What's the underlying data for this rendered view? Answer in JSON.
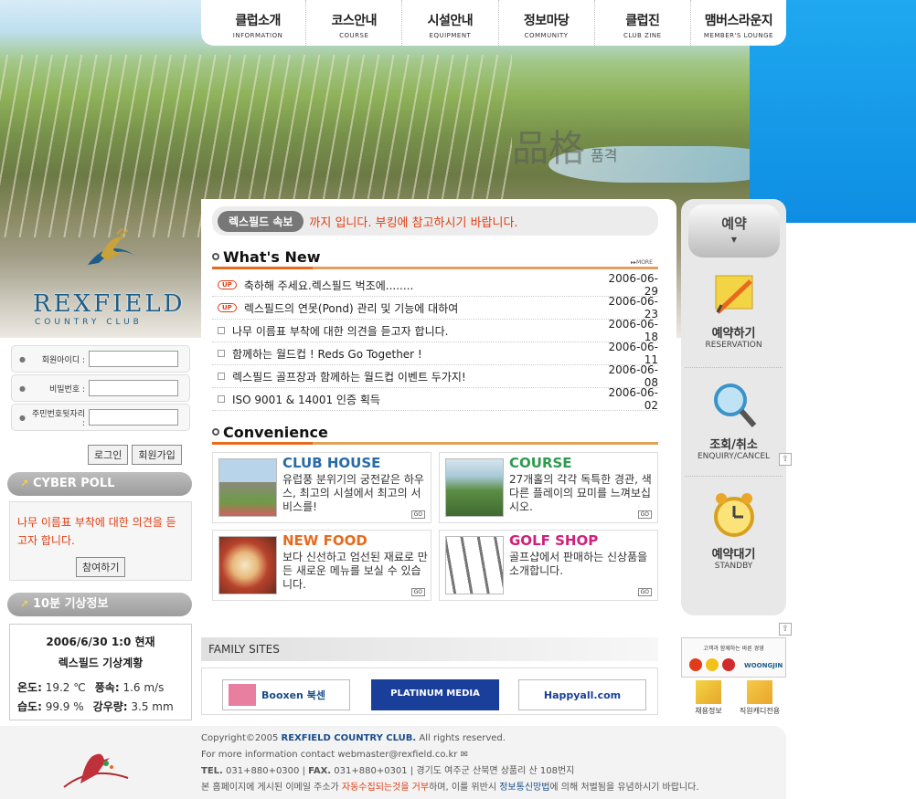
{
  "nav": [
    {
      "kr": "클럽소개",
      "en": "INFORMATION"
    },
    {
      "kr": "코스안내",
      "en": "COURSE"
    },
    {
      "kr": "시설안내",
      "en": "EQUIPMENT"
    },
    {
      "kr": "정보마당",
      "en": "COMMUNITY"
    },
    {
      "kr": "클럽진",
      "en": "CLUB ZINE"
    },
    {
      "kr": "맴버스라운지",
      "en": "MEMBER'S LOUNGE"
    }
  ],
  "hero": {
    "watermark": "品格",
    "watermark_sub": "품격"
  },
  "logo": {
    "name": "REXFIELD",
    "sub": "COUNTRY CLUB"
  },
  "login": {
    "id_label": "회원아이디 :",
    "pw_label": "비밀번호 :",
    "jumin_label": "주민번호뒷자리 :",
    "login_btn": "로그인",
    "join_btn": "회원가입"
  },
  "poll": {
    "title": "CYBER POLL",
    "text": "나무 이름표 부착에 대한 의견을 듣고자 합니다.",
    "btn": "참여하기"
  },
  "weather": {
    "title": "10분 기상정보",
    "datetime": "2006/6/30 1:0 현재",
    "station": "렉스필드 기상계황",
    "temp_label": "온도:",
    "temp": "19.2 ℃",
    "wind_label": "풍속:",
    "wind": "1.6 m/s",
    "hum_label": "습도:",
    "hum": "99.9 %",
    "rain_label": "강우량:",
    "rain": "3.5 mm"
  },
  "ticker": {
    "badge": "렉스필드 속보",
    "text": "까지 입니다. 부킹에 참고하시기 바랍니다."
  },
  "whatsnew": {
    "title": "What's New",
    "more": "MORE",
    "items": [
      {
        "up": "UP",
        "title": "축하해 주세요.렉스필드 벅조에........",
        "date": "2006-06-29"
      },
      {
        "up": "UP",
        "title": "렉스필드의 연못(Pond) 관리 및 기능에 대하여",
        "date": "2006-06-23"
      },
      {
        "up": "",
        "title": "나무 이름표 부착에 대한 의견을 듣고자 합니다.",
        "date": "2006-06-18"
      },
      {
        "up": "",
        "title": "함께하는 월드컵 ! Reds Go Together !",
        "date": "2006-06-11"
      },
      {
        "up": "",
        "title": "렉스필드 골프장과 함께하는 월드컵 이벤트 두가지!",
        "date": "2006-06-08"
      },
      {
        "up": "",
        "title": "ISO 9001 & 14001 인증 획득",
        "date": "2006-06-02"
      }
    ]
  },
  "convenience": {
    "title": "Convenience",
    "cards": [
      {
        "title": "CLUB HOUSE",
        "desc": "유럽풍 분위기의 궁전같은 하우스, 최고의 시설에서 최고의 서비스를!",
        "go": "GO",
        "color": "#2a6aa8"
      },
      {
        "title": "COURSE",
        "desc": "27개홀의 각각 독특한 경관, 색다른 플레이의 묘미를 느껴보십시오.",
        "go": "GO",
        "color": "#2e9b4f"
      },
      {
        "title": "NEW FOOD",
        "desc": "보다 신선하고 엄선된 재료로 만든 새로운 메뉴를 보실 수 있습니다.",
        "go": "GO",
        "color": "#e86a1c"
      },
      {
        "title": "GOLF SHOP",
        "desc": "골프샵에서 판매하는 신상품을 소개합니다.",
        "go": "GO",
        "color": "#d0207a"
      }
    ]
  },
  "reservation": {
    "title": "예약",
    "items": [
      {
        "kr": "예약하기",
        "en": "RESERVATION"
      },
      {
        "kr": "조회/취소",
        "en": "ENQUIRY/CANCEL"
      },
      {
        "kr": "예약대기",
        "en": "STANDBY"
      }
    ]
  },
  "family": {
    "title": "FAMILY SITES",
    "sites": [
      "Booxen 북센",
      "PLATINUM MEDIA",
      "Happyall.com"
    ]
  },
  "coupon": {
    "text": "고객과 함께하는 바른 경영",
    "brand": "WOONGJIN"
  },
  "minilinks": [
    "채용정보",
    "직원캐디전용"
  ],
  "footer": {
    "copyright_pre": "Copyright©2005 ",
    "copyright_name": "REXFIELD COUNTRY CLUB.",
    "copyright_post": " All rights reserved.",
    "contact": "For more information contact webmaster@rexfield.co.kr",
    "tel_label": "TEL.",
    "tel": "031+880+0300",
    "fax_label": "FAX.",
    "fax": "031+880+0301",
    "address": "| 경기도 여주군 산북면 상품리 산 108번지",
    "notice_pre": "본 홈페이지에 게시된 이메일 주소가 ",
    "notice_red": "자동수집되는것을 거부",
    "notice_mid": "하며, 이를 위반시 ",
    "notice_law": "정보통신망법",
    "notice_post": "에 의해 처벌됨을 유념하시기 바랍니다."
  }
}
